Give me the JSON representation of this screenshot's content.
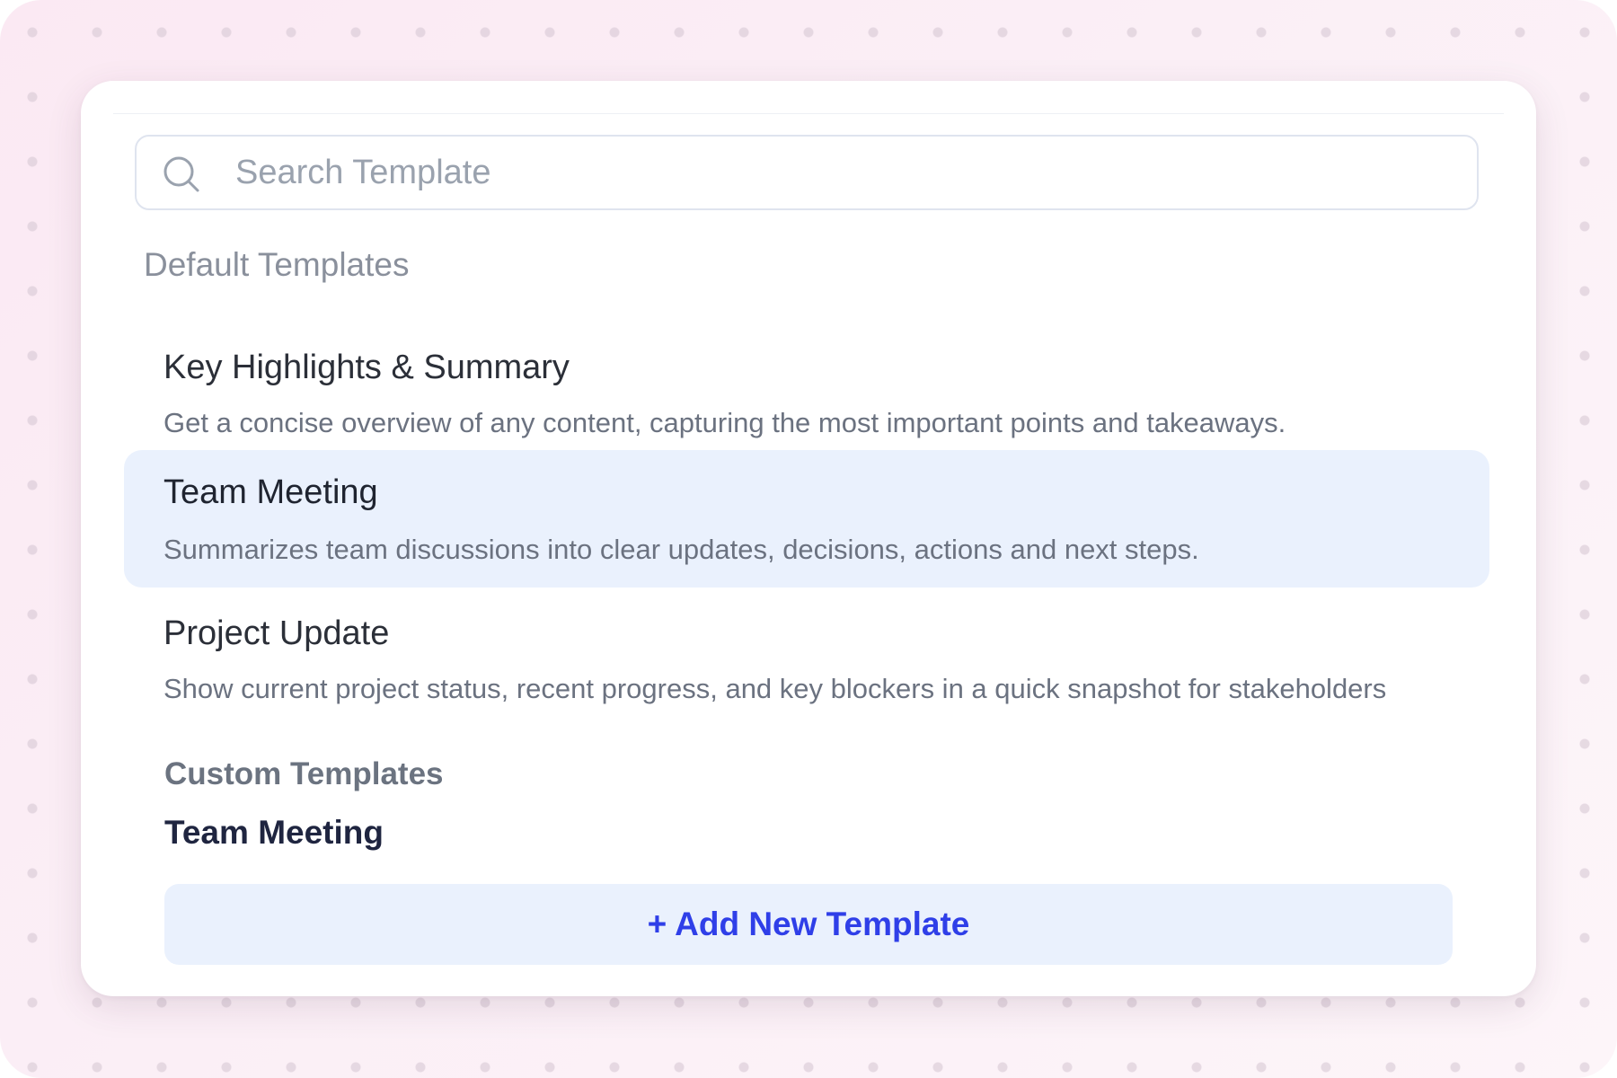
{
  "search": {
    "placeholder": "Search Template",
    "icon": "search-icon"
  },
  "default_section": {
    "label": "Default Templates",
    "items": [
      {
        "title": "Key Highlights & Summary",
        "description": "Get a concise overview of any content, capturing the most important points and takeaways.",
        "selected": false
      },
      {
        "title": "Team Meeting",
        "description": "Summarizes team discussions into clear updates, decisions, actions and next steps.",
        "selected": true
      },
      {
        "title": "Project Update",
        "description": "Show current project status, recent progress, and key blockers in a quick snapshot for stakeholders",
        "selected": false
      }
    ]
  },
  "custom_section": {
    "label": "Custom Templates",
    "items": [
      {
        "title": "Team Meeting"
      }
    ]
  },
  "add_button": {
    "label": "+ Add New Template"
  },
  "colors": {
    "accent": "#2f3fe8",
    "selected_background": "#eaf1fd",
    "page_background": "#fbe9f3"
  }
}
